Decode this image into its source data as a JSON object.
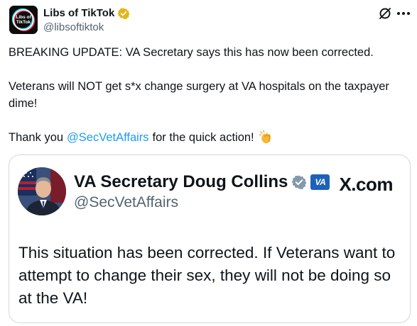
{
  "author": {
    "display_name": "Libs of TikTok",
    "handle": "@libsoftiktok",
    "avatar_text_line1": "Libs of",
    "avatar_text_line2": "TikTok",
    "verified": true,
    "verified_badge_color": "#e2b719"
  },
  "header_actions": {
    "grok_icon": "grok-icon",
    "more_icon": "more-icon"
  },
  "tweet": {
    "line1": "BREAKING UPDATE: VA Secretary says this has now been corrected.",
    "line2": "Veterans will NOT get s*x change surgery at VA hospitals on the taxpayer dime!",
    "line3_before": "Thank you",
    "line3_mention": "@SecVetAffairs",
    "line3_after": "for the quick action!",
    "emoji": "clapping-hands"
  },
  "embedded_card": {
    "display_name": "VA Secretary Doug Collins",
    "handle": "@SecVetAffairs",
    "verified_badge_color": "#829aab",
    "affiliate_badge_text": "VA",
    "affiliate_badge_color": "#1e62b8",
    "site_label": "X.com",
    "text": "This situation has been corrected. If Veterans want to attempt to change their sex, they will not be doing so at the VA!"
  },
  "colors": {
    "text": "#0f1419",
    "secondary_text": "#536471",
    "link": "#1d9bf0",
    "border": "#cfd9de"
  }
}
